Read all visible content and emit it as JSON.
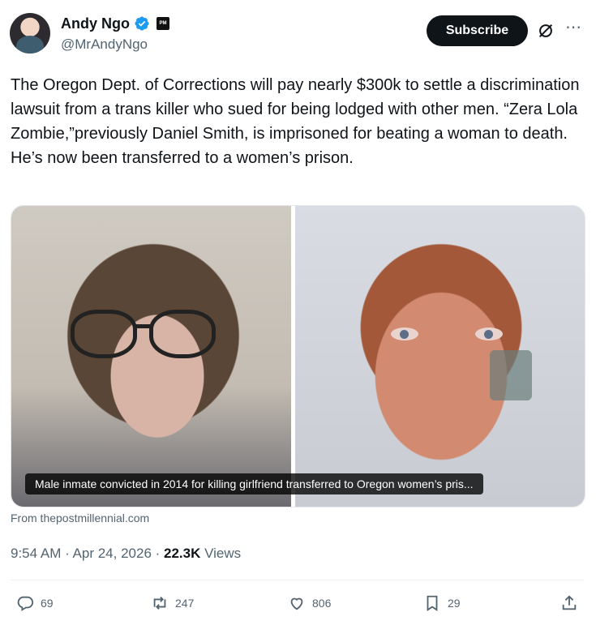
{
  "author": {
    "name": "Andy Ngo",
    "handle": "@MrAndyNgo",
    "affiliate_badge": "PM"
  },
  "header": {
    "subscribe_label": "Subscribe",
    "grok_icon": "grok-icon",
    "more_icon": "more-icon"
  },
  "tweet": {
    "text": "The Oregon Dept. of Corrections will pay nearly $300k to settle a discrimination lawsuit from a trans killer who sued for being lodged with other men. “Zera Lola Zombie,”previously Daniel Smith, is imprisoned for beating a woman to death. He’s now been transferred to a women’s prison."
  },
  "card": {
    "caption": "Male inmate convicted in 2014 for killing girlfriend transferred to Oregon women’s pris...",
    "source": "From thepostmillennial.com"
  },
  "meta": {
    "time": "9:54 AM",
    "date": "Apr 24, 2026",
    "views_count": "22.3K",
    "views_label": "Views"
  },
  "actions": {
    "replies": "69",
    "reposts": "247",
    "likes": "806",
    "bookmarks": "29"
  },
  "colors": {
    "verified": "#1d9bf0",
    "text_primary": "#0f1419",
    "text_secondary": "#536471"
  }
}
